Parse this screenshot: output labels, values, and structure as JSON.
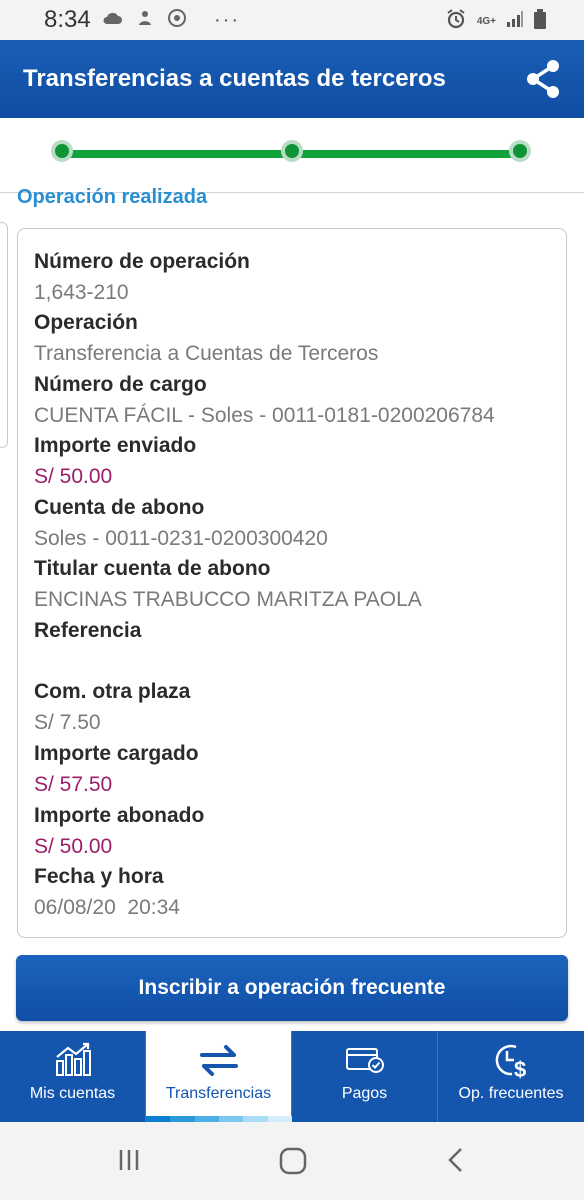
{
  "status_bar": {
    "time": "8:34",
    "dots": "···",
    "network_label": "4G+",
    "icons_left": [
      "cloud-icon",
      "upload-icon",
      "chrome-icon"
    ],
    "icons_right": [
      "alarm-icon",
      "signal-icon",
      "battery-icon"
    ]
  },
  "header": {
    "title": "Transferencias a cuentas de terceros",
    "share_icon": "share-icon"
  },
  "stepper": {
    "steps": 3,
    "completed": 3,
    "color": "#12a23b"
  },
  "section_title": "Operación realizada",
  "details": [
    {
      "label": "Número de operación",
      "value": "1,643-210",
      "money": false
    },
    {
      "label": "Operación",
      "value": "Transferencia a Cuentas de Terceros",
      "money": false
    },
    {
      "label": "Número de cargo",
      "value": "CUENTA FÁCIL - Soles - 0011-0181-0200206784",
      "money": false
    },
    {
      "label": "Importe enviado",
      "value": "S/ 50.00",
      "money": true
    },
    {
      "label": "Cuenta de abono",
      "value": "Soles - 0011-0231-0200300420",
      "money": false
    },
    {
      "label": "Titular cuenta de abono",
      "value": "ENCINAS TRABUCCO MARITZA PAOLA",
      "money": false
    },
    {
      "label": "Referencia",
      "value": "",
      "money": false
    },
    {
      "label": "Com. otra plaza",
      "value": "S/ 7.50",
      "money": false
    },
    {
      "label": "Importe cargado",
      "value": "S/ 57.50",
      "money": true
    },
    {
      "label": "Importe abonado",
      "value": "S/ 50.00",
      "money": true
    },
    {
      "label": "Fecha y hora",
      "value": "06/08/20  20:34",
      "money": false
    }
  ],
  "cta_label": "Inscribir a operación frecuente",
  "bottom_nav": [
    {
      "label": "Mis cuentas",
      "icon": "chart-icon",
      "active": false
    },
    {
      "label": "Transferencias",
      "icon": "transfer-arrows-icon",
      "active": true
    },
    {
      "label": "Pagos",
      "icon": "card-check-icon",
      "active": false
    },
    {
      "label": "Op. frecuentes",
      "icon": "clock-dollar-icon",
      "active": false
    }
  ],
  "colors": {
    "brand": "#1456ae",
    "accent_link": "#2a8fd0",
    "money": "#9c1e68",
    "progress": "#12a23b"
  }
}
